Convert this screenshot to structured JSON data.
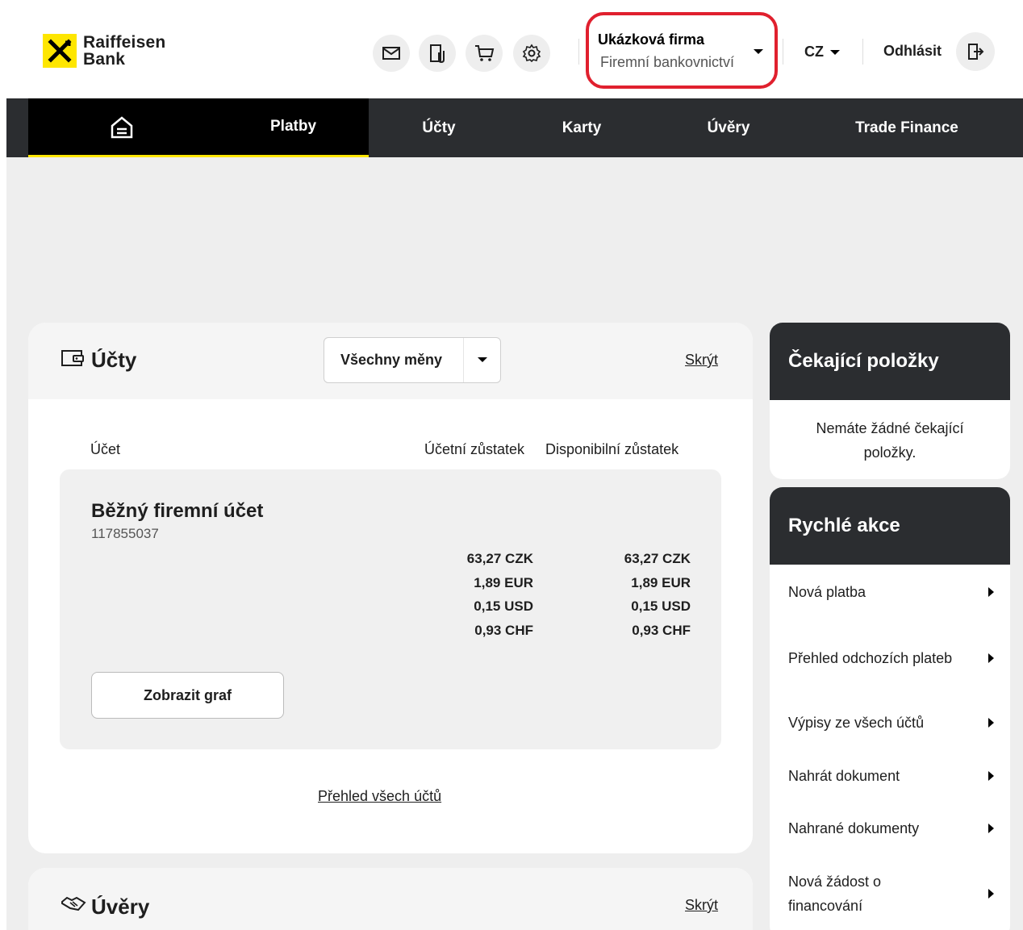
{
  "header": {
    "logo_line1": "Raiffeisen",
    "logo_line2": "Bank",
    "icons": [
      "mail-icon",
      "documents-icon",
      "cart-icon",
      "settings-icon"
    ],
    "company_name": "Ukázková firma",
    "company_sub": "Firemní bankovnictví",
    "language": "CZ",
    "logout": "Odhlásit"
  },
  "nav": {
    "items": [
      "Platby",
      "Účty",
      "Karty",
      "Úvěry",
      "Trade Finance"
    ]
  },
  "accounts": {
    "title": "Účty",
    "currency_select": "Všechny měny",
    "hide_link": "Skrýt",
    "col_account": "Účet",
    "col_booked": "Účetní zůstatek",
    "col_available": "Disponibilní zůstatek",
    "account_name": "Běžný firemní účet",
    "account_number": "117855037",
    "booked": [
      "63,27 CZK",
      "1,89 EUR",
      "0,15 USD",
      "0,93 CHF"
    ],
    "available": [
      "63,27 CZK",
      "1,89 EUR",
      "0,15 USD",
      "0,93 CHF"
    ],
    "graph_button": "Zobrazit graf",
    "all_accounts_link": "Přehled všech účtů"
  },
  "loans": {
    "title": "Úvěry",
    "hide_link": "Skrýt"
  },
  "pending": {
    "title": "Čekající položky",
    "text": "Nemáte žádné čekající položky."
  },
  "quick_actions": {
    "title": "Rychlé akce",
    "items": [
      "Nová platba",
      "Přehled odchozích plateb",
      "Výpisy ze všech účtů",
      "Nahrát dokument",
      "Nahrané dokumenty",
      "Nová žádost o financování"
    ]
  },
  "colors": {
    "brand_yellow": "#fee600",
    "dark": "#2b2d30",
    "highlight_red": "#e0202e"
  }
}
